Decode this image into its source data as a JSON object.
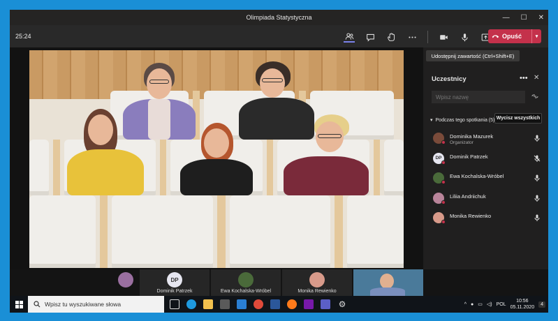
{
  "window": {
    "title": "Olimpiada Statystyczna",
    "controls": [
      "—",
      "☐",
      "✕"
    ]
  },
  "toolbar": {
    "timer": "25:24",
    "leave_label": "Opuść",
    "tooltip": "Udostępnij zawartość (Ctrl+Shift+E)",
    "icons": [
      "participants-icon",
      "chat-icon",
      "raise-hand-icon",
      "more-icon",
      "camera-icon",
      "mic-icon",
      "share-icon"
    ]
  },
  "panel": {
    "title": "Uczestnicy",
    "search_placeholder": "Wpisz nazwę",
    "section_label": "Podczas tego spotkania (5)",
    "mute_all_label": "Wycisz wszystkich",
    "participants": [
      {
        "name": "Dominika Mazurek",
        "role": "Organizator",
        "initials": "",
        "mic": "on",
        "avatar_color": "#7a4b3a"
      },
      {
        "name": "Dominik Patrzek",
        "role": "",
        "initials": "DP",
        "mic": "off",
        "avatar_color": "#e6e6f0"
      },
      {
        "name": "Ewa Kochalska-Wróbel",
        "role": "",
        "initials": "",
        "mic": "on",
        "avatar_color": "#4a6a3a"
      },
      {
        "name": "Liliia Andriichuk",
        "role": "",
        "initials": "",
        "mic": "on",
        "avatar_color": "#b9849a"
      },
      {
        "name": "Monika Rewienko",
        "role": "",
        "initials": "",
        "mic": "on",
        "avatar_color": "#d89a8a"
      }
    ]
  },
  "strip": {
    "thumbs": [
      {
        "name": "",
        "initials": "",
        "color": "#9a6fa0"
      },
      {
        "name": "Dominik Patrzek",
        "initials": "DP",
        "color": "#e6e6f0"
      },
      {
        "name": "Ewa Kochalska-Wróbel",
        "initials": "",
        "color": "#4a6a3a"
      },
      {
        "name": "Monika Rewienko",
        "initials": "",
        "color": "#d89a8a"
      }
    ]
  },
  "taskbar": {
    "search_placeholder": "Wpisz tu wyszukiwane słowa",
    "language": "POL",
    "time": "10:56",
    "date": "05.11.2020",
    "notifications": "4"
  },
  "colors": {
    "accent": "#7b83eb",
    "leave": "#c4314b",
    "desktop": "#1a8fd6"
  }
}
